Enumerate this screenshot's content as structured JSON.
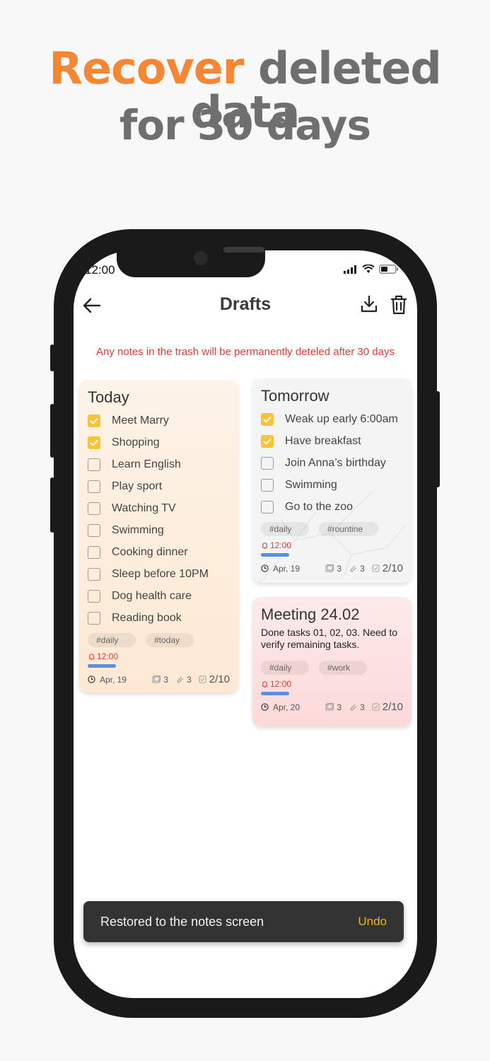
{
  "headline": {
    "accent_word": "Recover",
    "line1_rest": " deleted data",
    "line2": "for 30 days"
  },
  "colors": {
    "accent": "#f58634",
    "headline_gray": "#6f6f6f",
    "warning_red": "#e53935",
    "checkbox_checked": "#f9c43a",
    "progress_blue": "#5b8fe0",
    "undo_yellow": "#f2b31a"
  },
  "status_bar": {
    "time": "12:00"
  },
  "appbar": {
    "title": "Drafts",
    "icons": [
      "back-arrow-icon",
      "download-icon",
      "trash-icon"
    ]
  },
  "notice": "Any notes in the trash will be permanently deteled after 30 days",
  "cards": {
    "today": {
      "title": "Today",
      "background": "#fdf1e3",
      "tasks": [
        {
          "label": "Meet Marry",
          "checked": true
        },
        {
          "label": "Shopping",
          "checked": true
        },
        {
          "label": "Learn English",
          "checked": false
        },
        {
          "label": "Play sport",
          "checked": false
        },
        {
          "label": "Watching TV",
          "checked": false
        },
        {
          "label": "Swimming",
          "checked": false
        },
        {
          "label": "Cooking dinner",
          "checked": false
        },
        {
          "label": "Sleep before 10PM",
          "checked": false
        },
        {
          "label": "Dog health care",
          "checked": false
        },
        {
          "label": "Reading book",
          "checked": false
        }
      ],
      "tags": [
        "#daily",
        "#today"
      ],
      "alarm": "12:00",
      "date": "Apr, 19",
      "images": "3",
      "attachments": "3",
      "progress": "2/10"
    },
    "tomorrow": {
      "title": "Tomorrow",
      "background": "#f5f5f5",
      "tasks": [
        {
          "label": "Weak up early 6:00am",
          "checked": true
        },
        {
          "label": "Have breakfast",
          "checked": true
        },
        {
          "label": "Join Anna’s birthday",
          "checked": false
        },
        {
          "label": "Swimming",
          "checked": false
        },
        {
          "label": "Go to the zoo",
          "checked": false
        }
      ],
      "tags": [
        "#daily",
        "#rountine"
      ],
      "alarm": "12:00",
      "date": "Apr, 19",
      "images": "3",
      "attachments": "3",
      "progress": "2/10"
    },
    "meeting": {
      "title": "Meeting 24.02",
      "background": "#fde4e4",
      "body": "Done tasks 01, 02, 03. Need to verify remaining tasks.",
      "tags": [
        "#daily",
        "#work"
      ],
      "alarm": "12:00",
      "date": "Apr, 20",
      "images": "3",
      "attachments": "3",
      "progress": "2/10"
    }
  },
  "snackbar": {
    "message": "Restored to the notes screen",
    "action": "Undo"
  }
}
